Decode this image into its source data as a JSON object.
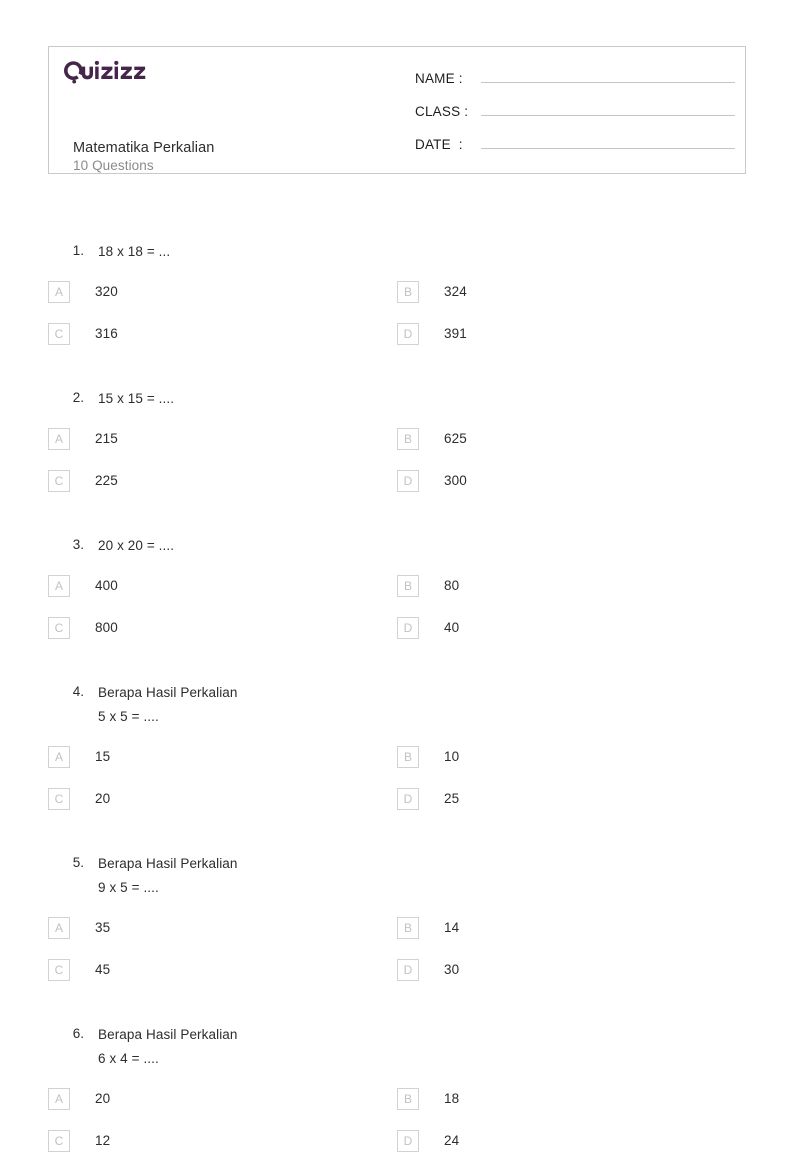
{
  "header": {
    "logo_text": "Quizizz",
    "logo_color": "#46254a",
    "title": "Matematika Perkalian",
    "question_count_label": "10 Questions",
    "fields": [
      {
        "label": "NAME :",
        "value": ""
      },
      {
        "label": "CLASS :",
        "value": ""
      },
      {
        "label": "DATE  :",
        "value": ""
      }
    ]
  },
  "questions": [
    {
      "number": "1.",
      "text": "18 x 18 = ...",
      "options": [
        {
          "letter": "A",
          "text": "320"
        },
        {
          "letter": "B",
          "text": "324"
        },
        {
          "letter": "C",
          "text": "316"
        },
        {
          "letter": "D",
          "text": "391"
        }
      ]
    },
    {
      "number": "2.",
      "text": "15 x 15 = ....",
      "options": [
        {
          "letter": "A",
          "text": "215"
        },
        {
          "letter": "B",
          "text": "625"
        },
        {
          "letter": "C",
          "text": "225"
        },
        {
          "letter": "D",
          "text": "300"
        }
      ]
    },
    {
      "number": "3.",
      "text": "20 x 20 = ....",
      "options": [
        {
          "letter": "A",
          "text": "400"
        },
        {
          "letter": "B",
          "text": "80"
        },
        {
          "letter": "C",
          "text": "800"
        },
        {
          "letter": "D",
          "text": "40"
        }
      ]
    },
    {
      "number": "4.",
      "text": "Berapa Hasil Perkalian\n5 x 5 = ....",
      "options": [
        {
          "letter": "A",
          "text": "15"
        },
        {
          "letter": "B",
          "text": "10"
        },
        {
          "letter": "C",
          "text": "20"
        },
        {
          "letter": "D",
          "text": "25"
        }
      ]
    },
    {
      "number": "5.",
      "text": "Berapa Hasil Perkalian\n9 x 5 = ....",
      "options": [
        {
          "letter": "A",
          "text": "35"
        },
        {
          "letter": "B",
          "text": "14"
        },
        {
          "letter": "C",
          "text": "45"
        },
        {
          "letter": "D",
          "text": "30"
        }
      ]
    },
    {
      "number": "6.",
      "text": "Berapa Hasil Perkalian\n6 x 4 = ....",
      "options": [
        {
          "letter": "A",
          "text": "20"
        },
        {
          "letter": "B",
          "text": "18"
        },
        {
          "letter": "C",
          "text": "12"
        },
        {
          "letter": "D",
          "text": "24"
        }
      ]
    }
  ]
}
